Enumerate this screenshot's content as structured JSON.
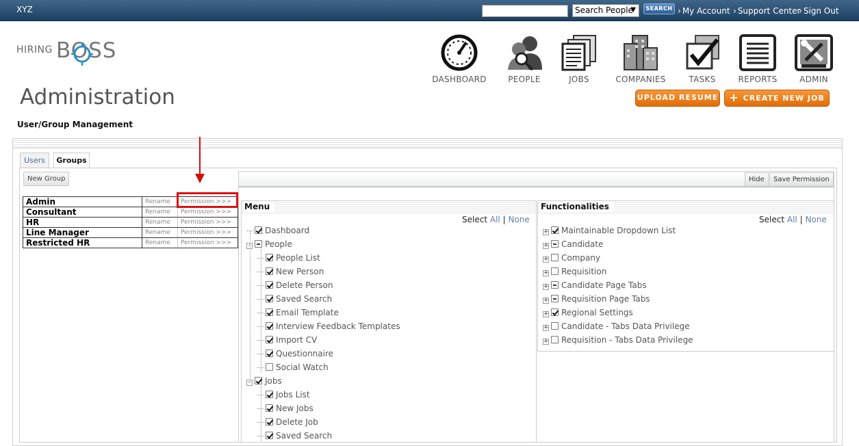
{
  "topbar": {
    "brand": "XYZ",
    "search_select": "Search People",
    "search_button": "SEARCH",
    "links": [
      "My Account",
      "Support Center",
      "Sign Out"
    ]
  },
  "logo": {
    "part1": "HIRING",
    "part2": "BOSS"
  },
  "nav": [
    "DASHBOARD",
    "PEOPLE",
    "JOBS",
    "COMPANIES",
    "TASKS",
    "REPORTS",
    "ADMIN"
  ],
  "page": {
    "title": "Administration",
    "upload_resume": "UPLOAD RESUME",
    "create_job": "CREATE NEW JOB",
    "subtitle": "User/Group Management"
  },
  "tabs": {
    "users": "Users",
    "groups": "Groups"
  },
  "groups": {
    "new_button": "New Group",
    "rename_label": "Rename",
    "permission_label": "Permission >>>",
    "rows": [
      "Admin",
      "Consultant",
      "HR",
      "Line Manager",
      "Restricted HR"
    ]
  },
  "toolbar": {
    "hide": "Hide",
    "save": "Save Permission"
  },
  "menu_panel": {
    "title": "Menu",
    "select_label": "Select",
    "all": "All",
    "sep": "|",
    "none": "None",
    "items": [
      {
        "label": "Dashboard",
        "state": "checked",
        "level": 0,
        "toggle": ""
      },
      {
        "label": "People",
        "state": "partial",
        "level": 0,
        "toggle": "-"
      },
      {
        "label": "People List",
        "state": "checked",
        "level": 1,
        "toggle": ""
      },
      {
        "label": "New Person",
        "state": "checked",
        "level": 1,
        "toggle": ""
      },
      {
        "label": "Delete Person",
        "state": "checked",
        "level": 1,
        "toggle": ""
      },
      {
        "label": "Saved Search",
        "state": "checked",
        "level": 1,
        "toggle": ""
      },
      {
        "label": "Email Template",
        "state": "checked",
        "level": 1,
        "toggle": ""
      },
      {
        "label": "Interview Feedback Templates",
        "state": "checked",
        "level": 1,
        "toggle": ""
      },
      {
        "label": "Import CV",
        "state": "checked",
        "level": 1,
        "toggle": ""
      },
      {
        "label": "Questionnaire",
        "state": "checked",
        "level": 1,
        "toggle": ""
      },
      {
        "label": "Social Watch",
        "state": "unchecked",
        "level": 1,
        "toggle": ""
      },
      {
        "label": "Jobs",
        "state": "checked",
        "level": 0,
        "toggle": "-"
      },
      {
        "label": "Jobs List",
        "state": "checked",
        "level": 1,
        "toggle": ""
      },
      {
        "label": "New Jobs",
        "state": "checked",
        "level": 1,
        "toggle": ""
      },
      {
        "label": "Delete Job",
        "state": "checked",
        "level": 1,
        "toggle": ""
      },
      {
        "label": "Saved Search",
        "state": "checked",
        "level": 1,
        "toggle": ""
      }
    ]
  },
  "func_panel": {
    "title": "Functionalities",
    "select_label": "Select",
    "all": "All",
    "sep": "|",
    "none": "None",
    "items": [
      {
        "label": "Maintainable Dropdown List",
        "state": "checked"
      },
      {
        "label": "Candidate",
        "state": "partial"
      },
      {
        "label": "Company",
        "state": "unchecked"
      },
      {
        "label": "Requisition",
        "state": "unchecked"
      },
      {
        "label": "Candidate Page Tabs",
        "state": "partial"
      },
      {
        "label": "Requisition Page Tabs",
        "state": "partial"
      },
      {
        "label": "Regional Settings",
        "state": "checked"
      },
      {
        "label": "Candidate - Tabs Data Privilege",
        "state": "unchecked"
      },
      {
        "label": "Requisition - Tabs Data Privilege",
        "state": "unchecked"
      }
    ]
  },
  "colors": {
    "topbar": "#1d4061",
    "accent_orange": "#e06d09",
    "highlight_red": "#e01010"
  }
}
